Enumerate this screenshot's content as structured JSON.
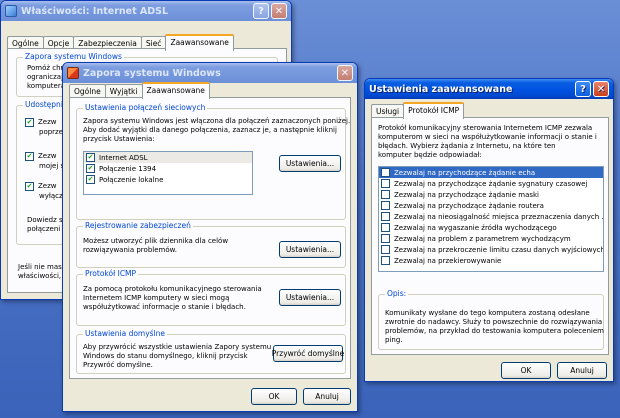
{
  "back_window": {
    "title": "Właściwości: Internet ADSL",
    "help": "?",
    "close": "✕",
    "tabs": [
      "Ogólne",
      "Opcje",
      "Zabezpieczenia",
      "Sieć",
      "Zaawansowane"
    ],
    "group1_title": "Zapora systemu Windows",
    "group1_text": [
      "Pomóż chr",
      "ograniczaj",
      "komputera"
    ],
    "group2_title": "Udostępni",
    "group2_items": [
      "Zezw",
      "poprze",
      "Zezw",
      "mojej s",
      "Zezw",
      "wyłącz"
    ],
    "group2_more": "Dowiedz s",
    "group2_more2": "połączeni",
    "bottom_text": [
      "Jeśli nie masz",
      "właściwości,"
    ]
  },
  "firewall_window": {
    "title": "Zapora systemu Windows",
    "close": "✕",
    "tabs": [
      "Ogólne",
      "Wyjątki",
      "Zaawansowane"
    ],
    "conn_group": {
      "title": "Ustawienia połączeń sieciowych",
      "desc": [
        "Zapora systemu Windows jest włączona dla połączeń zaznaczonych poniżej.",
        "Aby dodać wyjątki dla danego połączenia, zaznacz je, a następnie kliknij",
        "przycisk Ustawienia:"
      ],
      "connections": [
        "Internet ADSL",
        "Połączenie 1394",
        "Połączenie lokalne"
      ],
      "settings_btn": "Ustawienia..."
    },
    "log_group": {
      "title": "Rejestrowanie zabezpieczeń",
      "desc": [
        "Możesz utworzyć plik dziennika dla celów",
        "rozwiązywania problemów."
      ],
      "settings_btn": "Ustawienia..."
    },
    "icmp_group": {
      "title": "Protokół ICMP",
      "desc": [
        "Za pomocą protokołu komunikacyjnego sterowania",
        "Internetem ICMP komputery w sieci mogą",
        "współużytkować informacje o stanie i błędach."
      ],
      "settings_btn": "Ustawienia..."
    },
    "default_group": {
      "title": "Ustawienia domyślne",
      "desc": [
        "Aby przywrócić wszystkie ustawienia Zapory systemu",
        "Windows do stanu domyślnego, kliknij przycisk",
        "Przywróć domyślne."
      ],
      "restore_btn": "Przywróć domyślne"
    },
    "ok_btn": "OK",
    "cancel_btn": "Anuluj"
  },
  "advanced_window": {
    "title": "Ustawienia zaawansowane",
    "help": "?",
    "close": "✕",
    "tabs": [
      "Usługi",
      "Protokół ICMP"
    ],
    "intro": [
      "Protokół komunikacyjny sterowania Internetem ICMP zezwala",
      "komputerom w sieci na współużytkowanie informacji o stanie i",
      "błędach. Wybierz żądania z Internetu, na które ten",
      "komputer będzie odpowiadał:"
    ],
    "icmp_options": [
      "Zezwalaj na przychodzące żądanie echa",
      "Zezwalaj na przychodzące żądanie sygnatury czasowej",
      "Zezwalaj na przychodzące żądanie maski",
      "Zezwalaj na przychodzące żądanie routera",
      "Zezwalaj na nieosiągalność miejsca przeznaczenia danych ...",
      "Zezwalaj na wygaszanie źródła wychodzącego",
      "Zezwalaj na problem z parametrem wychodzącym",
      "Zezwalaj na przekroczenie limitu czasu danych wyjściowych",
      "Zezwalaj na przekierowywanie"
    ],
    "desc_group": {
      "title": "Opis:",
      "text": [
        "Komunikaty wysłane do tego komputera zostaną odesłane",
        "zwrotnie do nadawcy. Służy to powszechnie do rozwiązywania",
        "problemów, na przykład do testowania komputera poleceniem",
        "ping."
      ]
    },
    "ok_btn": "OK",
    "cancel_btn": "Anuluj"
  }
}
